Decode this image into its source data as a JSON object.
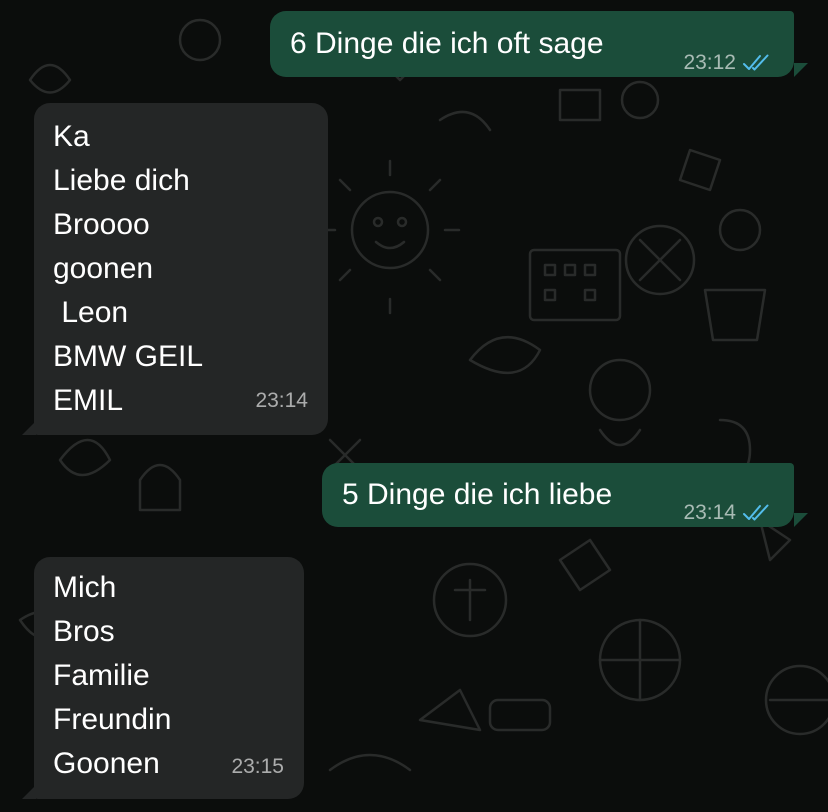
{
  "colors": {
    "outgoing_bubble": "#1b4d3a",
    "incoming_bubble": "#242626",
    "background": "#0b0d0c",
    "read_ticks": "#53bdeb"
  },
  "messages": [
    {
      "direction": "outgoing",
      "lines": [
        "6 Dinge die ich oft sage"
      ],
      "time": "23:12",
      "status_icon": "double-check-read-icon"
    },
    {
      "direction": "incoming",
      "lines": [
        "Ka",
        "Liebe dich",
        "Broooo",
        "goonen",
        " Leon",
        "BMW GEIL",
        "EMIL"
      ],
      "time": "23:14"
    },
    {
      "direction": "outgoing",
      "lines": [
        "5 Dinge die ich liebe"
      ],
      "time": "23:14",
      "status_icon": "double-check-read-icon"
    },
    {
      "direction": "incoming",
      "lines": [
        "Mich",
        "Bros",
        "Familie",
        "Freundin",
        "Goonen"
      ],
      "time": "23:15"
    }
  ]
}
